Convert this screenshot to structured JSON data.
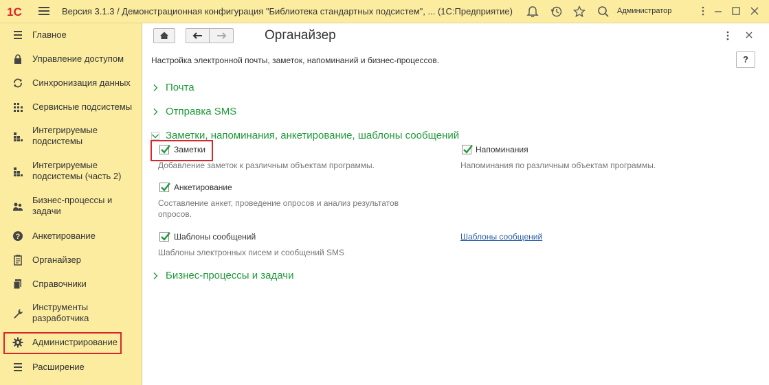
{
  "titlebar": {
    "logo_text": "1С",
    "title": "Версия 3.1.3 / Демонстрационная конфигурация \"Библиотека стандартных подсистем\", ...  (1С:Предприятие)",
    "user": "Администратор",
    "icons": [
      "bell-icon",
      "history-icon",
      "star-icon",
      "search-icon"
    ]
  },
  "sidebar": {
    "items": [
      {
        "label": "Главное",
        "icon": "menu-lines-icon"
      },
      {
        "label": "Управление доступом",
        "icon": "lock-icon"
      },
      {
        "label": "Синхронизация данных",
        "icon": "sync-icon"
      },
      {
        "label": "Сервисные подсистемы",
        "icon": "grid-dots-icon"
      },
      {
        "label": "Интегрируемые подсистемы",
        "icon": "blocks-icon"
      },
      {
        "label": "Интегрируемые подсистемы (часть 2)",
        "icon": "blocks-icon"
      },
      {
        "label": "Бизнес-процессы и задачи",
        "icon": "people-icon"
      },
      {
        "label": "Анкетирование",
        "icon": "question-icon"
      },
      {
        "label": "Органайзер",
        "icon": "notepad-icon"
      },
      {
        "label": "Справочники",
        "icon": "books-icon"
      },
      {
        "label": "Инструменты разработчика",
        "icon": "wrench-icon"
      },
      {
        "label": "Администрирование",
        "icon": "gear-icon",
        "active": true
      },
      {
        "label": "Расширение",
        "icon": "menu-lines-icon"
      }
    ]
  },
  "main": {
    "title": "Органайзер",
    "help_label": "?",
    "description": "Настройка электронной почты, заметок, напоминаний и бизнес-процессов.",
    "sections": {
      "mail": "Почта",
      "sms": "Отправка SMS",
      "notes": "Заметки, напоминания, анкетирование, шаблоны сообщений",
      "bp": "Бизнес-процессы и задачи"
    },
    "options": {
      "notes": {
        "label": "Заметки",
        "checked": true,
        "hint": "Добавление заметок к различным объектам программы."
      },
      "reminders": {
        "label": "Напоминания",
        "checked": true,
        "hint": "Напоминания по различным объектам программы."
      },
      "surveys": {
        "label": "Анкетирование",
        "checked": true,
        "hint_line1": "Составление анкет, проведение опросов и анализ результатов",
        "hint_line2": "опросов."
      },
      "templates": {
        "label": "Шаблоны сообщений",
        "checked": true,
        "hint": "Шаблоны электронных писем и сообщений SMS",
        "link": "Шаблоны сообщений"
      }
    }
  },
  "colors": {
    "panel": "#fbeca0",
    "section_green": "#1f9a3a",
    "check_green": "#1f9a3a",
    "highlight_red": "#d9262c",
    "link_blue": "#2a5fa8"
  }
}
